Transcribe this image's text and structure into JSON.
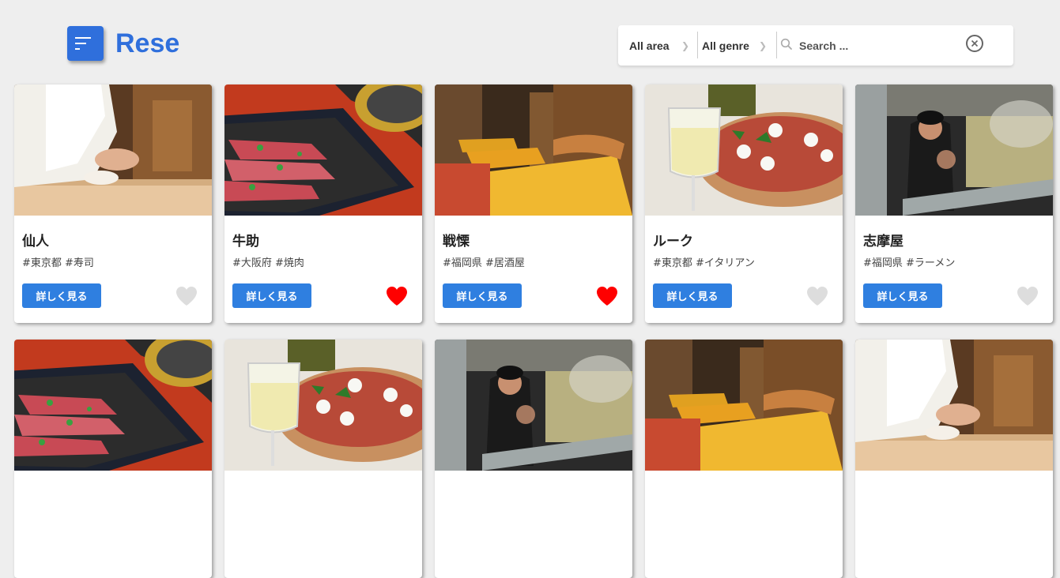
{
  "brand": {
    "name": "Rese"
  },
  "search": {
    "area": "All area",
    "genre": "All genre",
    "placeholder": "Search ...",
    "value": ""
  },
  "colors": {
    "accent": "#2f6fdc",
    "button": "#2f7fe0",
    "favorite_on": "#ff0000",
    "favorite_off": "#dddddd"
  },
  "shops": [
    {
      "name": "仙人",
      "tags": "#東京都 #寿司",
      "detail_label": "詳しく見る",
      "favorite": false,
      "image": "sushi-chef"
    },
    {
      "name": "牛助",
      "tags": "#大阪府 #焼肉",
      "detail_label": "詳しく見る",
      "favorite": true,
      "image": "yakiniku-meat"
    },
    {
      "name": "戦慄",
      "tags": "#福岡県 #居酒屋",
      "detail_label": "詳しく見る",
      "favorite": true,
      "image": "izakaya-tables"
    },
    {
      "name": "ルーク",
      "tags": "#東京都 #イタリアン",
      "detail_label": "詳しく見る",
      "favorite": false,
      "image": "pizza-wine"
    },
    {
      "name": "志摩屋",
      "tags": "#福岡県 #ラーメン",
      "detail_label": "詳しく見る",
      "favorite": false,
      "image": "ramen-kitchen"
    },
    {
      "image": "yakiniku-meat"
    },
    {
      "image": "pizza-wine"
    },
    {
      "image": "ramen-kitchen"
    },
    {
      "image": "izakaya-tables"
    },
    {
      "image": "sushi-chef"
    }
  ]
}
